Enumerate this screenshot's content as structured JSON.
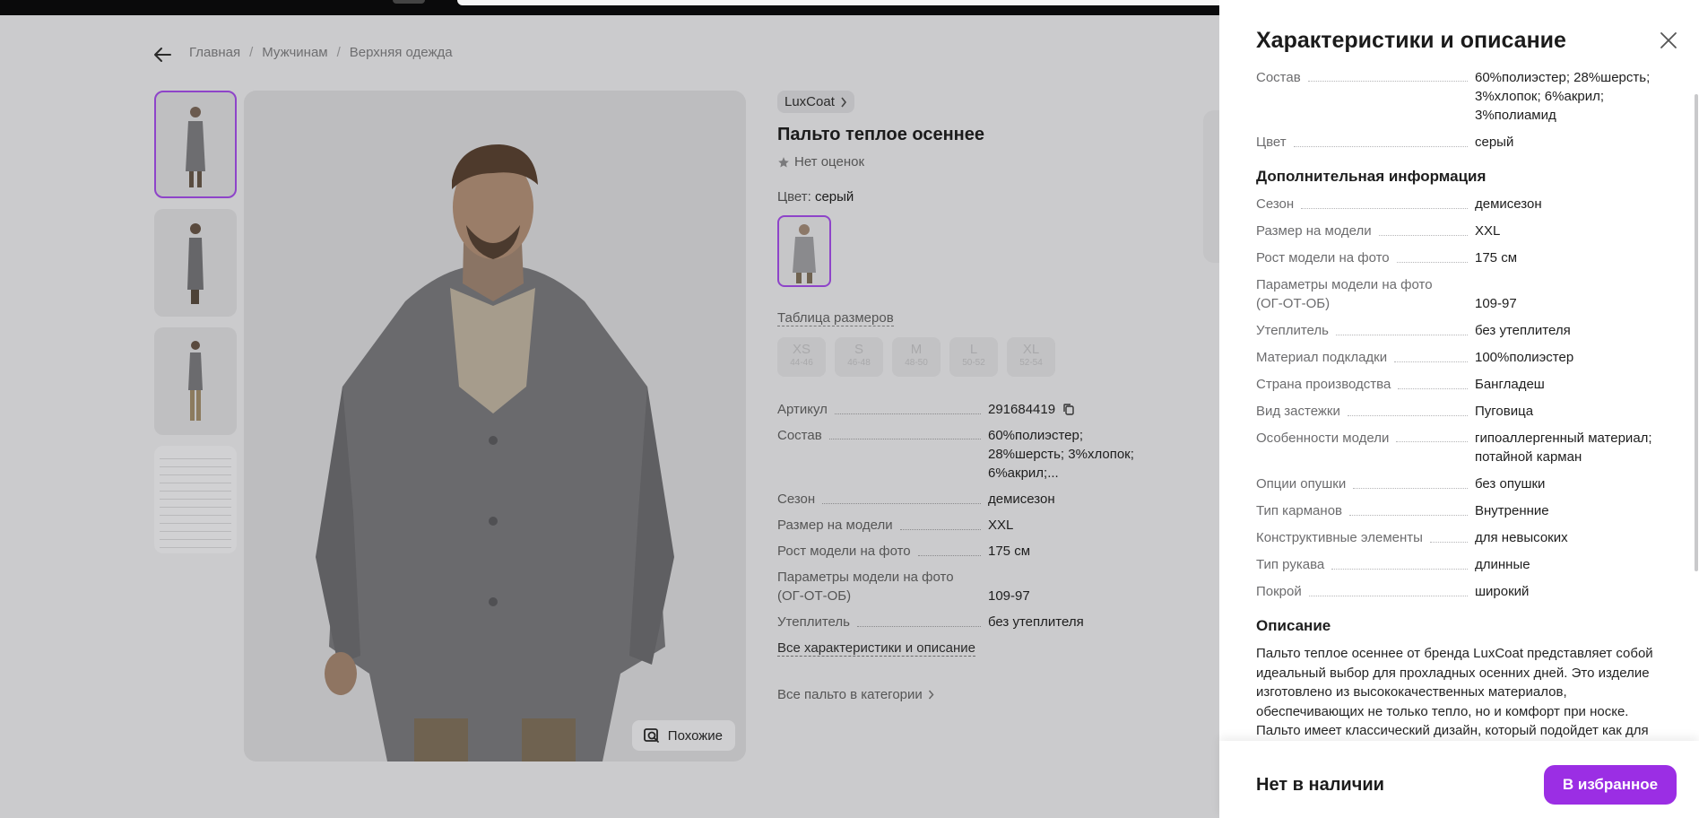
{
  "breadcrumbs": [
    "Главная",
    "Мужчинам",
    "Верхняя одежда"
  ],
  "product": {
    "brand": "LuxCoat",
    "title": "Пальто теплое осеннее",
    "rating_text": "Нет оценок",
    "color_label": "Цвет:",
    "color_value": "серый",
    "size_table_link": "Таблица размеров",
    "sizes": [
      {
        "size": "XS",
        "range": "44-46"
      },
      {
        "size": "S",
        "range": "46-48"
      },
      {
        "size": "M",
        "range": "48-50"
      },
      {
        "size": "L",
        "range": "50-52"
      },
      {
        "size": "XL",
        "range": "52-54"
      }
    ],
    "specs": [
      {
        "k": "Артикул",
        "v": "291684419"
      },
      {
        "k": "Состав",
        "v": "60%полиэстер; 28%шерсть; 3%хлопок; 6%акрил;..."
      },
      {
        "k": "Сезон",
        "v": "демисезон"
      },
      {
        "k": "Размер на модели",
        "v": "XXL"
      },
      {
        "k": "Рост модели на фото",
        "v": "175 см"
      },
      {
        "k": "Параметры модели на фото (ОГ-ОТ-ОБ)",
        "v": "109-97"
      },
      {
        "k": "Утеплитель",
        "v": "без утеплителя"
      }
    ],
    "all_specs_link": "Все характеристики и описание",
    "category_link": "Все пальто в категории",
    "similar_button": "Похожие"
  },
  "drawer": {
    "title": "Характеристики и описание",
    "top_rows": [
      {
        "k": "Состав",
        "v": "60%полиэстер; 28%шерсть; 3%хлопок; 6%акрил; 3%полиамид"
      },
      {
        "k": "Цвет",
        "v": "серый"
      }
    ],
    "extra_title": "Дополнительная информация",
    "extra_rows": [
      {
        "k": "Сезон",
        "v": "демисезон"
      },
      {
        "k": "Размер на модели",
        "v": "XXL"
      },
      {
        "k": "Рост модели на фото",
        "v": "175 см"
      },
      {
        "k": "Параметры модели на фото (ОГ-ОТ-ОБ)",
        "v": "109-97"
      },
      {
        "k": "Утеплитель",
        "v": "без утеплителя"
      },
      {
        "k": "Материал подкладки",
        "v": "100%полиэстер"
      },
      {
        "k": "Страна производства",
        "v": "Бангладеш"
      },
      {
        "k": "Вид застежки",
        "v": "Пуговица"
      },
      {
        "k": "Особенности модели",
        "v": "гипоаллергенный материал; потайной карман"
      },
      {
        "k": "Опции опушки",
        "v": "без опушки"
      },
      {
        "k": "Тип карманов",
        "v": "Внутренние"
      },
      {
        "k": "Конструктивные элементы",
        "v": "для невысоких"
      },
      {
        "k": "Тип рукава",
        "v": "длинные"
      },
      {
        "k": "Покрой",
        "v": "широкий"
      }
    ],
    "desc_title": "Описание",
    "description": "Пальто теплое осеннее от бренда LuxCoat представляет собой идеальный выбор для прохладных осенних дней. Это изделие изготовлено из высококачественных материалов, обеспечивающих не только тепло, но и комфорт при носке. Пальто имеет классический дизайн, который подойдет как для",
    "out_of_stock": "Нет в наличии",
    "favorite_button": "В избранное"
  },
  "colors": {
    "accent": "#9b2ee4",
    "selection_border": "#8e44c9"
  }
}
